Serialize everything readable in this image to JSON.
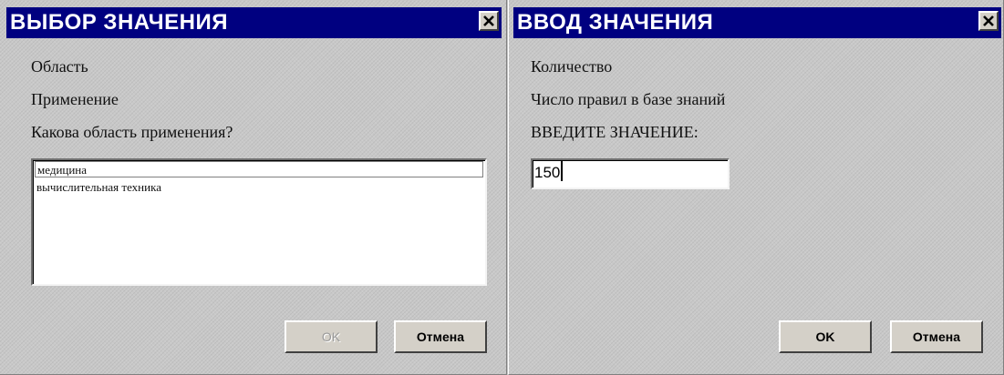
{
  "select_dialog": {
    "title": "ВЫБОР ЗНАЧЕНИЯ",
    "line1": "Область",
    "line2": "Применение",
    "question": "Какова область применения?",
    "options": [
      "медицина",
      "вычислительная техника"
    ],
    "selected_option": "медицина",
    "ok_label": "OK",
    "ok_enabled": false,
    "cancel_label": "Отмена"
  },
  "input_dialog": {
    "title": "ВВОД ЗНАЧЕНИЯ",
    "line1": "Количество",
    "line2": "Число правил в базе знаний",
    "prompt": "ВВЕДИТЕ ЗНАЧЕНИЕ:",
    "value": "150",
    "ok_label": "OK",
    "cancel_label": "Отмена"
  },
  "colors": {
    "titlebar": "#000080",
    "title_text": "#ffffff",
    "dialog_face": "#c8c8c8"
  },
  "icons": {
    "close": "close-icon",
    "caret": "text-cursor-icon"
  }
}
